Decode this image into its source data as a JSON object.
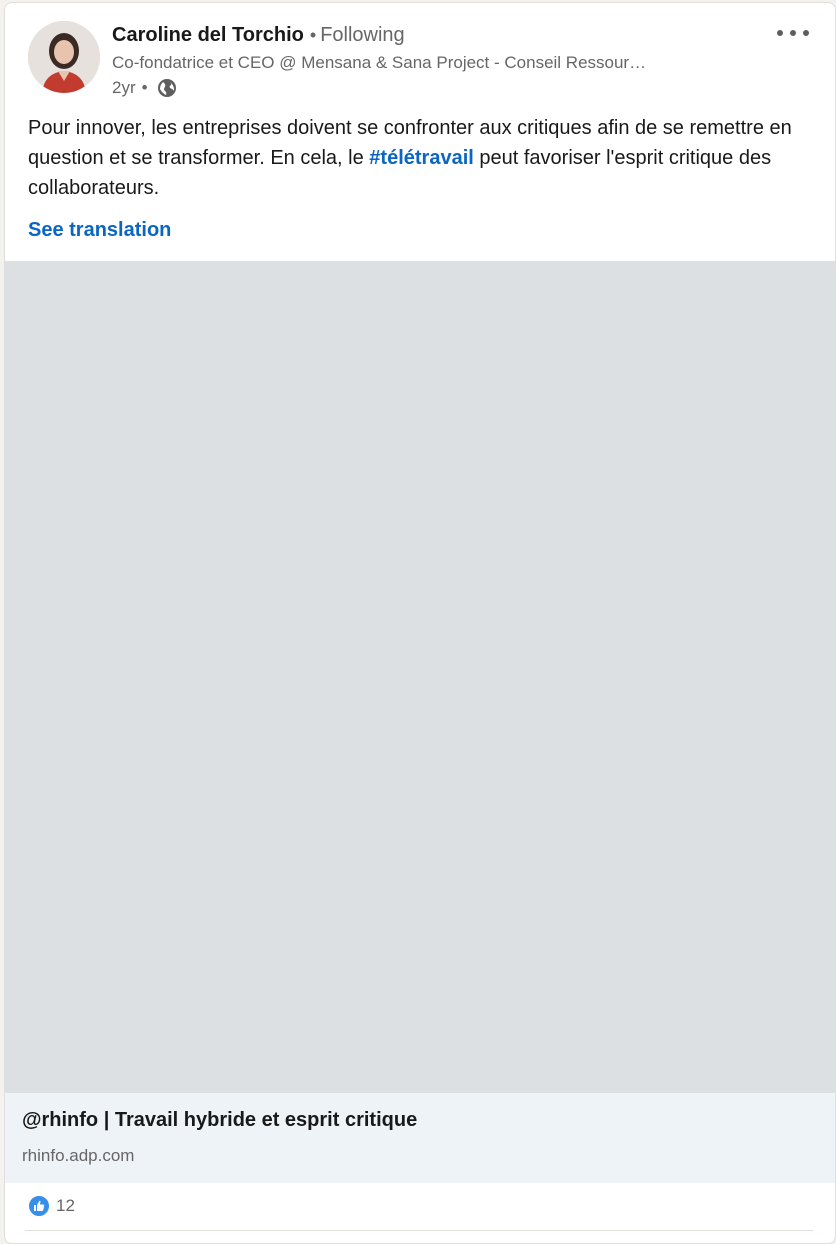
{
  "post": {
    "author": {
      "name": "Caroline del Torchio",
      "separator": "•",
      "follow_status": "Following",
      "headline": "Co-fondatrice et CEO @ Mensana & Sana Project - Conseil Ressour…",
      "time": "2yr",
      "time_separator": "•",
      "visibility_icon": "globe-icon"
    },
    "more_icon": "more-horizontal-icon",
    "text": {
      "part1": "Pour innover, les entreprises doivent se confronter aux critiques afin de se remettre en question et se transformer. En cela, le ",
      "hashtag": "#télétravail",
      "part2": " peut favoriser l'esprit critique des collaborateurs."
    },
    "see_translation": "See translation",
    "link_preview": {
      "title": "@rhinfo | Travail hybride et esprit critique",
      "domain": "rhinfo.adp.com"
    },
    "social": {
      "reaction_icon": "like-icon",
      "reaction_count": "12"
    }
  },
  "colors": {
    "link": "#0a66c2",
    "media_placeholder": "#dce0e3",
    "preview_bg": "#eef3f8",
    "secondary_text": "#666666"
  }
}
